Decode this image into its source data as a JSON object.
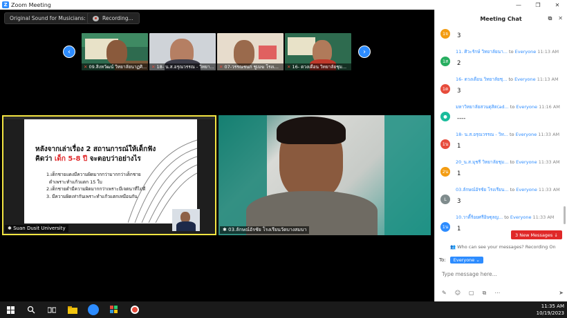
{
  "window": {
    "title": "Zoom Meeting",
    "controls": [
      "—",
      "❐",
      "✕"
    ]
  },
  "top_bar": {
    "original_sound": "Original Sound for Musicians: Off",
    "recording": "Recording..."
  },
  "thumbnails": [
    {
      "name": "09.สิงหวัฒน์ วิทยาลัยนาฏศิ..."
    },
    {
      "name": "18- น.ส.อรุณวรรณ - วิทยา..."
    },
    {
      "name": "07-วรรณชนก ชูเมฆ โรงเ..."
    },
    {
      "name": "16- ดวงเดือน วิทยาลัยชุม..."
    }
  ],
  "tiles": {
    "left_caption": "Suan Dusit University",
    "right_caption": "03.ลักษณ์อัรชัย โรงเรียนวัดบางสมบา"
  },
  "slide": {
    "title_line1": "หลังจากเล่าเรื่อง 2 สถานการณ์ให้เด็กฟัง",
    "title_line2_prefix": "คิดว่า ",
    "title_line2_red": "เด็ก 5-8 ปี",
    "title_line2_suffix": " จะตอบว่าอย่างไร",
    "items": [
      "1.เด็กชายแดงมีความผิดมากกว่ามากกว่าเด็กชาย",
      "ดำเพราะทำแก้วแตก 15 ใบ",
      "2.เด็กชายดำมีความผิดมากกว่าเพราะมีเจตนาที่ไม่ดี",
      "3. มีความผิดเท่ากันเพราะทำแก้วแตกเหมือนกัน"
    ]
  },
  "chat": {
    "title": "Meeting Chat",
    "messages": [
      {
        "avatar": "1จ",
        "color": "#f39c12",
        "sender": "",
        "to": "",
        "recipient": "",
        "time": "",
        "text": "3"
      },
      {
        "avatar": "1ส",
        "color": "#27ae60",
        "sender": "11. ศิวะรักษ์ วิทยาลัยนา...",
        "to": "to",
        "recipient": "Everyone",
        "time": "11:13 AM",
        "text": "2"
      },
      {
        "avatar": "1ด",
        "color": "#e74c3c",
        "sender": "16- ดวงเดือน วิทยาลัยชุ...",
        "to": "to",
        "recipient": "Everyone",
        "time": "11:13 AM",
        "text": "3"
      },
      {
        "avatar": "●",
        "color": "#1abc9c",
        "sender": "มหาวิทยาลัยสวนดุสิต(ad...",
        "to": "to",
        "recipient": "Everyone",
        "time": "11:16 AM",
        "text": "----"
      },
      {
        "avatar": "1น",
        "color": "#e74c3c",
        "sender": "18- น.ส.อรุณวรรณ - วิท...",
        "to": "to",
        "recipient": "Everyone",
        "time": "11:33 AM",
        "text": "1"
      },
      {
        "avatar": "2น",
        "color": "#f39c12",
        "sender": "20_น.ส.มุชรี วิทยาลัยชุม...",
        "to": "to",
        "recipient": "Everyone",
        "time": "11:33 AM",
        "text": "1"
      },
      {
        "avatar": "L",
        "color": "#7f8c8d",
        "sender": "03.ลักษณ์อัรชัย โรงเรียน...",
        "to": "to",
        "recipient": "Everyone",
        "time": "11:33 AM",
        "text": "3"
      },
      {
        "avatar": "1น",
        "color": "#2d8cff",
        "sender": "10.วาดี้ร้อยศรีอิษฐุลญ...",
        "to": "to",
        "recipient": "Everyone",
        "time": "11:33 AM",
        "text": "1"
      }
    ],
    "new_messages": "3 New Messages ↓",
    "who_can_see": "Who can see your messages? Recording On",
    "to_label": "To:",
    "to_value": "Everyone ⌄",
    "placeholder": "Type message here..."
  },
  "taskbar": {
    "time": "11:35 AM",
    "date": "10/19/2023"
  }
}
